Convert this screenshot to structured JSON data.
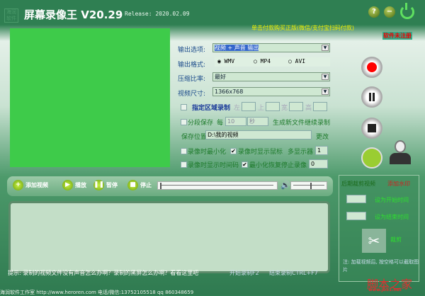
{
  "header": {
    "logo": "海润软件",
    "title": "屏幕录像王 V20.29",
    "release": "Release: 2020.02.09",
    "help": "?",
    "minimize": "−",
    "buy": "单击付款购买正版(微信/支付宝扫码付款)",
    "unregistered": "软件未注册"
  },
  "form": {
    "output_option_label": "输出选项:",
    "output_option_value": "视频 + 声音 输出",
    "format_label": "输出格式:",
    "formats": [
      "WMV",
      "MP4",
      "AVI"
    ],
    "format_selected": "WMV",
    "compression_label": "压缩比率:",
    "compression_value": "最好",
    "size_label": "视频尺寸:",
    "size_value": "1366x768",
    "region_label": "指定区域录制",
    "left": "左",
    "top": "上",
    "width": "宽",
    "height": "高",
    "segment_label": "分段保存",
    "every": "每",
    "segment_value": "10",
    "segment_unit": "秒",
    "segment_suffix": "生成新文件继续录制",
    "save_label": "保存位置",
    "save_path": "D:\\我的视频",
    "change": "更改",
    "minimize_label": "录像时最小化",
    "show_cursor_label": "录像时显示鼠标",
    "show_cursor_checked": true,
    "multi_monitor_label": "多显示器",
    "multi_monitor_value": "1",
    "timecode_label": "录像时显示时间码",
    "restore_stop_label": "最小化恢复停止录像",
    "restore_stop_checked": true,
    "restore_value": "0"
  },
  "toolbar": {
    "add": "添加视频",
    "play": "播放",
    "pause": "暂停",
    "stop": "停止",
    "progress": 0,
    "volume": 0.55
  },
  "right_panel": {
    "trim": "后期裁剪视频",
    "watermark": "添加水印",
    "set_start": "设为开始时间",
    "set_end": "设为结束时间",
    "cut": "裁剪",
    "note": "注: 加载视频后, 按空格可以截取图片"
  },
  "hint": "提示: 录制的视频文件没有声音怎么办啊？录制的黑屏怎么办啊？看看这里吧",
  "hotkey_start": "开始录制F2",
  "hotkey_end": "结束录制CTRL+F7",
  "footer": "海润软件工作室 http://www.heroren.com 电话/微信:13752105518 qq 860348659",
  "watermark_site": "脚本之家",
  "watermark_url": "www.jb51.net"
}
